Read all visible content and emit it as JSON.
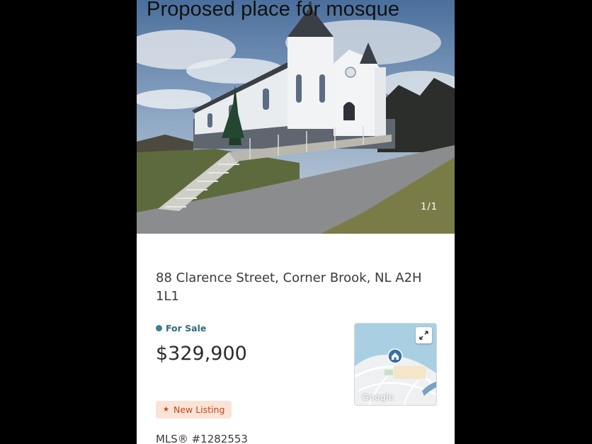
{
  "photo": {
    "caption": "Proposed place for mosque",
    "counter": "1/1"
  },
  "listing": {
    "address": "88 Clarence Street,  Corner Brook, NL A2H 1L1",
    "status": "For Sale",
    "price": "$329,900",
    "badge": "New Listing",
    "mls": "MLS® #1282553"
  },
  "map": {
    "attribution": "Google"
  },
  "icons": {
    "status": "status-dot-icon",
    "badge": "star-icon",
    "expand": "expand-icon",
    "marker": "home-marker-icon"
  },
  "colors": {
    "status": "#2f6b82",
    "badge_bg": "#fbe3d6",
    "badge_text": "#c4451e"
  }
}
